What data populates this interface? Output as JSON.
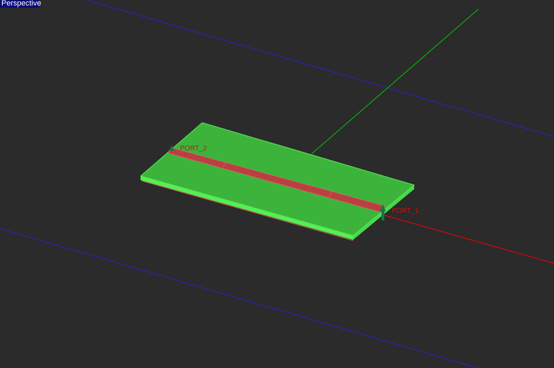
{
  "viewport": {
    "title": "Perspective"
  },
  "ports": [
    {
      "label": "PORT_2"
    },
    {
      "label": "PORT_1"
    }
  ],
  "colors": {
    "background": "#2b2b2b",
    "board": "#3cb43c",
    "board_edge": "#55ee55",
    "strip": "#b94040",
    "x_axis": "#ff0000",
    "y_axis": "#00cc00",
    "grid": "#2020dd",
    "port_label": "#cc1010"
  }
}
